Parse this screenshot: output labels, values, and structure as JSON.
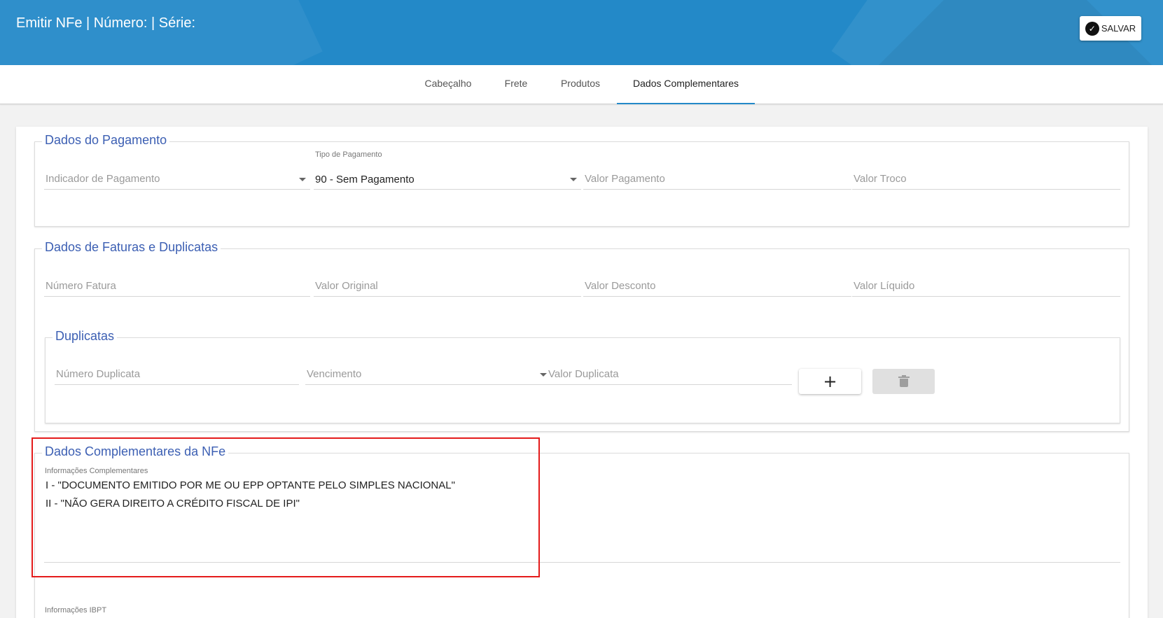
{
  "header": {
    "title": "Emitir NFe | Número: | Série:",
    "save_label": "SALVAR",
    "save_icon": "check-circle-icon",
    "color": "#2389c8"
  },
  "tabs": [
    {
      "label": "Cabeçalho",
      "active": false
    },
    {
      "label": "Frete",
      "active": false
    },
    {
      "label": "Produtos",
      "active": false
    },
    {
      "label": "Dados Complementares",
      "active": true
    }
  ],
  "pagamento": {
    "legend": "Dados do Pagamento",
    "indicador_placeholder": "Indicador de Pagamento",
    "tipo_label": "Tipo de Pagamento",
    "tipo_value": "90 - Sem Pagamento",
    "valor_pagamento_placeholder": "Valor Pagamento",
    "valor_troco_placeholder": "Valor Troco"
  },
  "faturas": {
    "legend": "Dados de Faturas e Duplicatas",
    "numero_fatura_placeholder": "Número Fatura",
    "valor_original_placeholder": "Valor Original",
    "valor_desconto_placeholder": "Valor Desconto",
    "valor_liquido_placeholder": "Valor Líquido"
  },
  "duplicatas": {
    "legend": "Duplicatas",
    "numero_placeholder": "Número Duplicata",
    "vencimento_placeholder": "Vencimento",
    "valor_placeholder": "Valor Duplicata",
    "add_label": "+",
    "delete_icon": "trash-icon"
  },
  "complementares": {
    "legend": "Dados Complementares da NFe",
    "info_label": "Informações Complementares",
    "lines": [
      "I - \"DOCUMENTO EMITIDO POR ME OU EPP OPTANTE PELO SIMPLES NACIONAL\"",
      "II - \"NÃO GERA DIREITO A CRÉDITO FISCAL DE IPI\""
    ],
    "ibpt_label": "Informações IBPT"
  },
  "colors": {
    "legend": "#3c5fb3",
    "highlight": "#e41b1b"
  }
}
